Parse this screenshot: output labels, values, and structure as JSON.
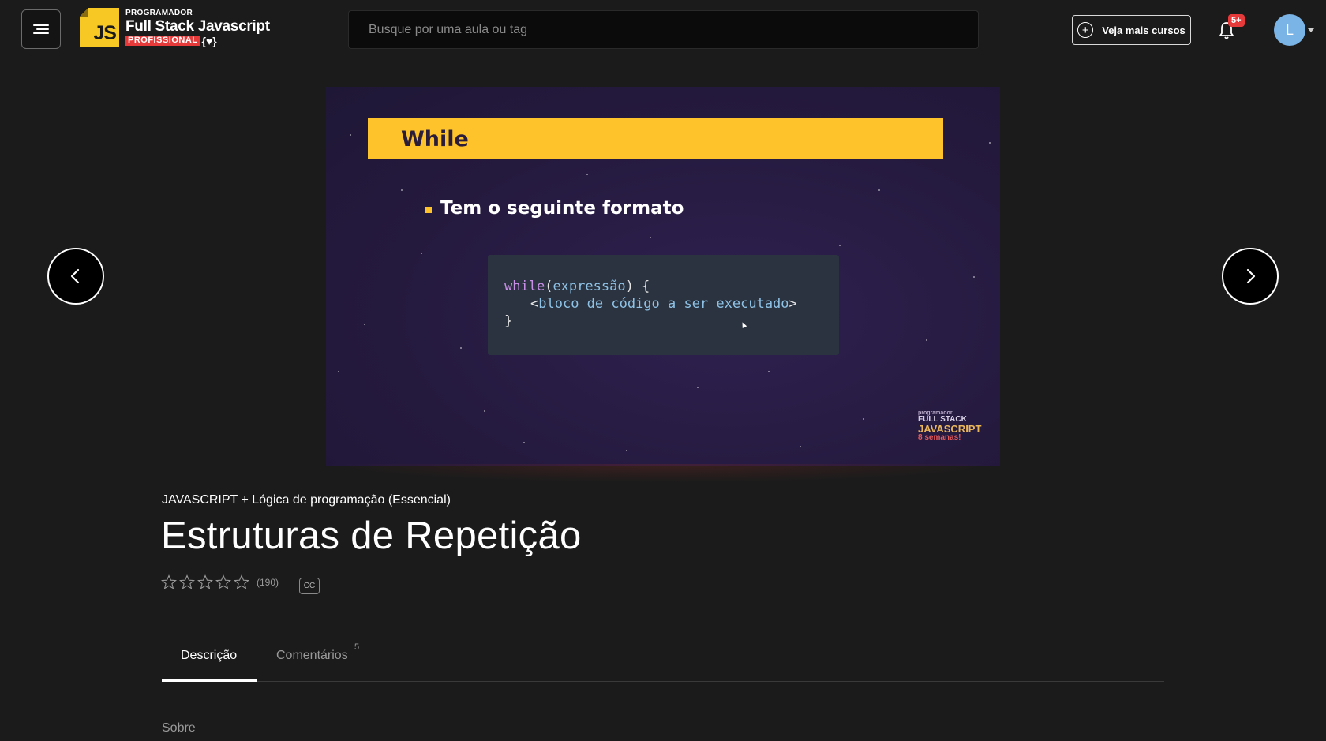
{
  "header": {
    "logo": {
      "js_text": "JS",
      "small": "PROGRAMADOR",
      "big": "Full Stack Javascript",
      "tag": "PROFISSIONAL",
      "brace": "{♥}"
    },
    "search_placeholder": "Busque por uma aula ou tag",
    "more_courses_label": "Veja mais cursos",
    "notifications_badge": "5+",
    "avatar_initial": "L"
  },
  "video": {
    "slide_title": "While",
    "bullet": "Tem o seguinte formato",
    "code": {
      "kw": "while",
      "open": "(",
      "arg": "expressão",
      "close": ") {",
      "lt": "<",
      "body": "bloco de código a ser executado",
      "gt": ">",
      "end": "}"
    },
    "watermark": {
      "line1": "programador",
      "line2": "FULL STACK",
      "line3": "JAVASCRIPT",
      "line4": "8 semanas!"
    }
  },
  "lesson": {
    "course_name": "JAVASCRIPT + Lógica de programação (Essencial)",
    "title": "Estruturas de Repetição",
    "rating_stars": 0,
    "rating_max": 5,
    "rating_count": "(190)",
    "cc_label": "CC"
  },
  "tabs": [
    {
      "label": "Descrição",
      "active": true
    },
    {
      "label": "Comentários",
      "count": "5",
      "active": false
    }
  ],
  "about_label": "Sobre",
  "colors": {
    "background": "#1b1b1b",
    "slide_yellow": "#fec22b",
    "slide_bg": "#251a3f",
    "badge_red": "#e63a3a",
    "avatar_blue": "#7ab3e6"
  }
}
